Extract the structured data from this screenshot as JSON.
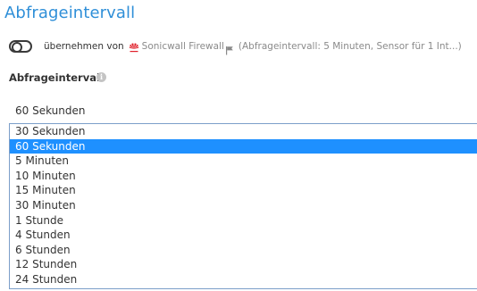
{
  "section": {
    "title": "Abfrageintervall"
  },
  "inherit": {
    "toggle_state": "off",
    "label": "übernehmen von",
    "device_icon": "huawei-logo-icon",
    "device_name": "Sonicwall Firewall",
    "flag_icon": "flag-icon",
    "note": "(Abfrageintervall: 5 Minuten, Sensor für 1 Int...)"
  },
  "field": {
    "label": "Abfrageintervall",
    "info_icon": "info-icon",
    "current_value": "60 Sekunden",
    "selected_index": 1,
    "options": [
      "30 Sekunden",
      "60 Sekunden",
      "5 Minuten",
      "10 Minuten",
      "15 Minuten",
      "30 Minuten",
      "1 Stunde",
      "4 Stunden",
      "6 Stunden",
      "12 Stunden",
      "24 Stunden"
    ]
  },
  "colors": {
    "title": "#2f8fd8",
    "selected_bg": "#1e90ff",
    "dropdown_border": "#7b9ec9",
    "muted_text": "#8a8a8a",
    "brand_red": "#e0202a"
  }
}
